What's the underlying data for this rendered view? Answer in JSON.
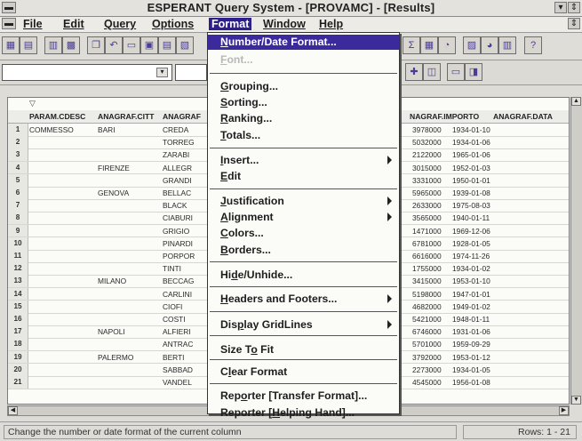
{
  "window": {
    "title": "ESPERANT Query System - [PROVAMC] - [Results]"
  },
  "menubar": {
    "items": [
      "File",
      "Edit",
      "Query",
      "Options",
      "Format",
      "Window",
      "Help"
    ],
    "active": "Format"
  },
  "toolbar": {
    "right_glyph": "?"
  },
  "grid": {
    "columns": [
      "PARAM.CDESC",
      "ANAGRAF.CITT",
      "ANAGRAF",
      "NAGRAF.IMPORTO",
      "ANAGRAF.DATA"
    ],
    "rows": [
      {
        "n": "1",
        "desc": "COMMESSO",
        "citta": "BARI",
        "nome": "CREDA",
        "importo": "3978000",
        "data": "1934-01-10"
      },
      {
        "n": "2",
        "desc": "",
        "citta": "",
        "nome": "TORREG",
        "importo": "5032000",
        "data": "1934-01-06"
      },
      {
        "n": "3",
        "desc": "",
        "citta": "",
        "nome": "ZARABI",
        "importo": "2122000",
        "data": "1965-01-06"
      },
      {
        "n": "4",
        "desc": "",
        "citta": "FIRENZE",
        "nome": "ALLEGR",
        "importo": "3015000",
        "data": "1952-01-03"
      },
      {
        "n": "5",
        "desc": "",
        "citta": "",
        "nome": "GRANDI",
        "importo": "3331000",
        "data": "1950-01-01"
      },
      {
        "n": "6",
        "desc": "",
        "citta": "GENOVA",
        "nome": "BELLAC",
        "importo": "5965000",
        "data": "1939-01-08"
      },
      {
        "n": "7",
        "desc": "",
        "citta": "",
        "nome": "BLACK",
        "importo": "2633000",
        "data": "1975-08-03"
      },
      {
        "n": "8",
        "desc": "",
        "citta": "",
        "nome": "CIABURI",
        "importo": "3565000",
        "data": "1940-01-11"
      },
      {
        "n": "9",
        "desc": "",
        "citta": "",
        "nome": "GRIGIO",
        "importo": "1471000",
        "data": "1969-12-06"
      },
      {
        "n": "10",
        "desc": "",
        "citta": "",
        "nome": "PINARDI",
        "importo": "6781000",
        "data": "1928-01-05"
      },
      {
        "n": "11",
        "desc": "",
        "citta": "",
        "nome": "PORPOR",
        "importo": "6616000",
        "data": "1974-11-26"
      },
      {
        "n": "12",
        "desc": "",
        "citta": "",
        "nome": "TINTI",
        "importo": "1755000",
        "data": "1934-01-02"
      },
      {
        "n": "13",
        "desc": "",
        "citta": "MILANO",
        "nome": "BECCAG",
        "importo": "3415000",
        "data": "1953-01-10"
      },
      {
        "n": "14",
        "desc": "",
        "citta": "",
        "nome": "CARLINI",
        "importo": "5198000",
        "data": "1947-01-01"
      },
      {
        "n": "15",
        "desc": "",
        "citta": "",
        "nome": "CIOFI",
        "importo": "4682000",
        "data": "1949-01-02"
      },
      {
        "n": "16",
        "desc": "",
        "citta": "",
        "nome": "COSTI",
        "importo": "5421000",
        "data": "1948-01-11"
      },
      {
        "n": "17",
        "desc": "",
        "citta": "NAPOLI",
        "nome": "ALFIERI",
        "importo": "6746000",
        "data": "1931-01-06"
      },
      {
        "n": "18",
        "desc": "",
        "citta": "",
        "nome": "ANTRAC",
        "importo": "5701000",
        "data": "1959-09-29"
      },
      {
        "n": "19",
        "desc": "",
        "citta": "PALERMO",
        "nome": "BERTI",
        "importo": "3792000",
        "data": "1953-01-12"
      },
      {
        "n": "20",
        "desc": "",
        "citta": "",
        "nome": "SABBAD",
        "importo": "2273000",
        "data": "1934-01-05"
      },
      {
        "n": "21",
        "desc": "",
        "citta": "",
        "nome": "VANDEL",
        "importo": "4545000",
        "data": "1956-01-08"
      }
    ]
  },
  "format_menu": {
    "items": [
      {
        "key": "number_date",
        "u": "N",
        "rest": "umber/Date Format...",
        "state": "highlighted"
      },
      {
        "key": "font",
        "u": "F",
        "rest": "ont...",
        "state": "disabled"
      },
      {
        "key": "grouping",
        "u": "G",
        "rest": "rouping..."
      },
      {
        "key": "sorting",
        "u": "S",
        "rest": "orting..."
      },
      {
        "key": "ranking",
        "u": "R",
        "rest": "anking..."
      },
      {
        "key": "totals",
        "u": "T",
        "rest": "otals..."
      },
      {
        "key": "insert",
        "u": "I",
        "rest": "nsert...",
        "submenu": true
      },
      {
        "key": "edit",
        "u": "E",
        "rest": "dit"
      },
      {
        "key": "justification",
        "u": "J",
        "rest": "ustification",
        "submenu": true
      },
      {
        "key": "alignment",
        "u": "A",
        "rest": "lignment",
        "submenu": true
      },
      {
        "key": "colors",
        "u": "C",
        "rest": "olors..."
      },
      {
        "key": "borders",
        "u": "B",
        "rest": "orders..."
      },
      {
        "key": "hide_unhide",
        "pre": "Hi",
        "u": "d",
        "rest": "e/Unhide..."
      },
      {
        "key": "headers_footers",
        "u": "H",
        "rest": "eaders and Footers...",
        "submenu": true
      },
      {
        "key": "display_gridlines",
        "pre": "Dis",
        "u": "p",
        "rest": "lay GridLines",
        "submenu": true
      },
      {
        "key": "size_to_fit",
        "pre": "Size T",
        "u": "o",
        "rest": " Fit"
      },
      {
        "key": "clear_format",
        "pre": "C",
        "u": "l",
        "rest": "ear Format"
      },
      {
        "key": "reporter_transfer",
        "pre": "Rep",
        "u": "o",
        "rest": "rter [Transfer Format]..."
      },
      {
        "key": "reporter_helping",
        "pre": "Reporter [",
        "u": "H",
        "rest": "elping Hand]..."
      }
    ]
  },
  "status": {
    "message": "Change the number or date format of the current column",
    "rows": "Rows: 1 - 21"
  }
}
